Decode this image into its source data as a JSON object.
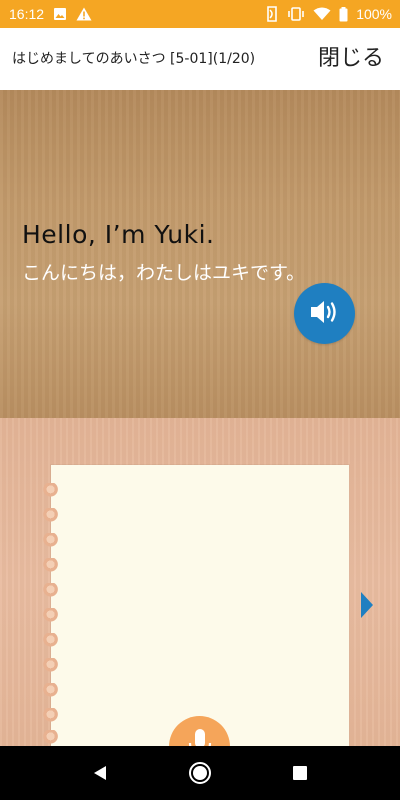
{
  "status_bar": {
    "time": "16:12",
    "battery": "100%",
    "left_icons": [
      "image-icon",
      "warning-icon"
    ],
    "right_icons": [
      "nfc-icon",
      "vibrate-icon",
      "wifi-icon",
      "battery-icon"
    ]
  },
  "header": {
    "title": "はじめましてのあいさつ  [5-01](1/20)",
    "close_label": "閉じる"
  },
  "prompt": {
    "english": "Hello, I’m Yuki.",
    "japanese": "こんにちは，わたしはユキです。",
    "speaker_icon": "speaker-icon"
  },
  "practice": {
    "mic_icon": "microphone-icon",
    "next_icon": "next-arrow-icon"
  },
  "nav": {
    "icons": [
      "back-icon",
      "home-icon",
      "recents-icon"
    ]
  },
  "colors": {
    "status_bar": "#f5a623",
    "speaker_button": "#1f7fc1",
    "mic_button": "#f5a55a",
    "next_arrow": "#1f7fc1"
  }
}
